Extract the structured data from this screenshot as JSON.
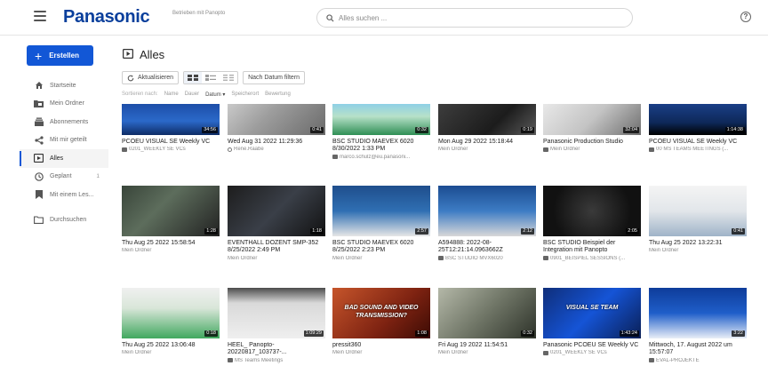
{
  "header": {
    "logo": "Panasonic",
    "powered_by": "Betrieben mit Panopto",
    "search_placeholder": "Alles suchen ..."
  },
  "sidebar": {
    "create_label": "Erstellen",
    "items": [
      {
        "label": "Startseite",
        "icon": "home-icon",
        "count": ""
      },
      {
        "label": "Mein Ordner",
        "icon": "folder-icon",
        "count": ""
      },
      {
        "label": "Abonnements",
        "icon": "subscriptions-icon",
        "count": ""
      },
      {
        "label": "Mit mir geteilt",
        "icon": "share-icon",
        "count": ""
      },
      {
        "label": "Alles",
        "icon": "library-icon",
        "count": "",
        "active": true
      },
      {
        "label": "Geplant",
        "icon": "clock-icon",
        "count": "1"
      },
      {
        "label": "Mit einem Les...",
        "icon": "bookmark-icon",
        "count": ""
      },
      {
        "label": "Durchsuchen",
        "icon": "browse-folder-icon",
        "count": ""
      }
    ]
  },
  "main": {
    "title": "Alles",
    "refresh_label": "Aktualisieren",
    "date_filter_label": "Nach Datum filtern",
    "sort": {
      "label": "Sortieren nach:",
      "options": [
        "Name",
        "Dauer",
        "Datum ▾",
        "Speicherort",
        "Bewertung"
      ],
      "active_index": 2
    }
  },
  "accent_color": "#1257d6",
  "brand_color": "#0a3f9c",
  "videos": [
    {
      "title": "PCOEU VISUAL SE Weekly VC",
      "meta": "0201_WEEKLY SE VCs",
      "meta_icon": "folder",
      "duration": "34:56"
    },
    {
      "title": "Wed Aug 31 2022 11:29:36",
      "meta": "Rene.Raabe",
      "meta_icon": "person",
      "duration": "0:41"
    },
    {
      "title": "BSC STUDIO MAEVEX 6020 8/30/2022 1:33 PM",
      "meta": "marco.schulz@eu.panasoni...",
      "meta_icon": "folder",
      "duration": "0:32"
    },
    {
      "title": "Mon Aug 29 2022 15:18:44",
      "meta": "Mein Ordner",
      "meta_icon": "",
      "duration": "0:19"
    },
    {
      "title": "Panasonic Production Studio",
      "meta": "Mein Ordner",
      "meta_icon": "folder",
      "duration": "32:04"
    },
    {
      "title": "PCOEU VISUAL SE Weekly VC",
      "meta": "00 MS TEAMS MEETINGS (...",
      "meta_icon": "folder",
      "duration": "1:14:38"
    },
    {
      "title": "Thu Aug 25 2022 15:58:54",
      "meta": "Mein Ordner",
      "meta_icon": "",
      "duration": "1:28"
    },
    {
      "title": "EVENTHALL DOZENT SMP-352 8/25/2022 2:49 PM",
      "meta": "Mein Ordner",
      "meta_icon": "",
      "duration": "1:18"
    },
    {
      "title": "BSC STUDIO MAEVEX 6020 8/25/2022 2:23 PM",
      "meta": "Mein Ordner",
      "meta_icon": "",
      "duration": "2:57"
    },
    {
      "title": "A594888: 2022-08-25T12:21:14.0963662Z",
      "meta": "BSC STUDIO MVX6020",
      "meta_icon": "folder",
      "duration": "2:12"
    },
    {
      "title": "BSC STUDIO Beispiel der Integration mit Panopto",
      "meta": "0901_BEISPIEL SESSIONS (...",
      "meta_icon": "folder",
      "duration": "2:05"
    },
    {
      "title": "Thu Aug 25 2022 13:22:31",
      "meta": "Mein Ordner",
      "meta_icon": "",
      "duration": "0:41"
    },
    {
      "title": "Thu Aug 25 2022 13:06:48",
      "meta": "Mein Ordner",
      "meta_icon": "",
      "duration": "0:18"
    },
    {
      "title": "HEEL_ Panopto-20220817_103737-...",
      "meta": "MS Teams Meetings",
      "meta_icon": "folder",
      "duration": "1:09:29"
    },
    {
      "title": "pressit360",
      "meta": "Mein Ordner",
      "meta_icon": "",
      "duration": "1:08",
      "overlay": "BAD SOUND AND VIDEO TRANSMISSION?"
    },
    {
      "title": "Fri Aug 19 2022 11:54:51",
      "meta": "Mein Ordner",
      "meta_icon": "",
      "duration": "0:32"
    },
    {
      "title": "Panasonic PCOEU SE Weekly VC",
      "meta": "0201_WEEKLY SE VCs",
      "meta_icon": "folder",
      "duration": "1:43:24",
      "overlay": "VISUAL SE TEAM"
    },
    {
      "title": "Mittwoch, 17. August 2022 um 15:57:07",
      "meta": "EVAL-PROJEKTE",
      "meta_icon": "folder",
      "duration": "3:22"
    }
  ]
}
